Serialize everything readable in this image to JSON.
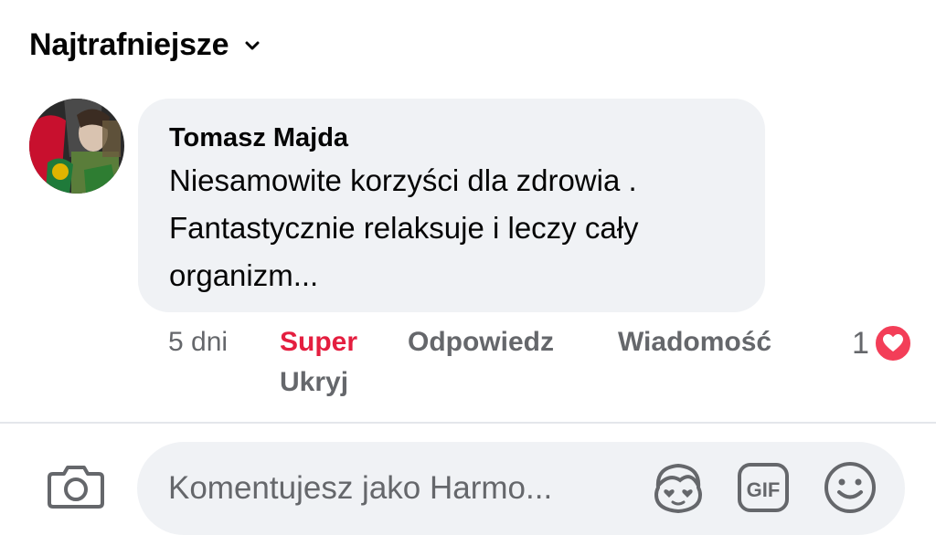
{
  "sort": {
    "label": "Najtrafniejsze"
  },
  "comment": {
    "author": "Tomasz Majda",
    "text": "Niesamowite korzyści dla zdrowia . Fantastycznie relaksuje i leczy cały organizm...",
    "time": "5 dni",
    "reaction_label": "Super",
    "reply_label": "Odpowiedz",
    "message_label": "Wiadomość",
    "hide_label": "Ukryj",
    "reaction_count": "1",
    "reaction_icon": "heart-icon",
    "reaction_color": "#f33e58",
    "reacted_color": "#e41e3f"
  },
  "composer": {
    "placeholder": "Komentujesz jako Harmo...",
    "icons": [
      "camera-icon",
      "avatar-sticker-icon",
      "gif-icon",
      "smiley-icon"
    ]
  }
}
